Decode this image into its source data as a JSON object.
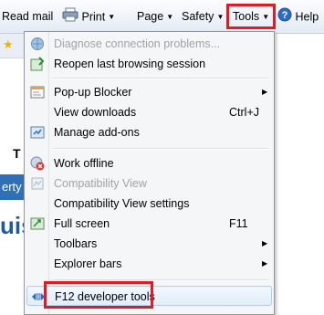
{
  "toolbar": {
    "read_mail": "Read mail",
    "print": "Print",
    "page": "Page",
    "safety": "Safety",
    "tools": "Tools",
    "help": "Help"
  },
  "background": {
    "tab_fragment": "T",
    "link_fragment": "erty",
    "heading_fragment": "uis"
  },
  "menu": {
    "items": [
      {
        "label": "Diagnose connection problems...",
        "disabled": true
      },
      {
        "label": "Reopen last browsing session"
      },
      {
        "label": "Pop-up Blocker",
        "submenu": true
      },
      {
        "label": "View downloads",
        "shortcut": "Ctrl+J"
      },
      {
        "label": "Manage add-ons"
      },
      {
        "label": "Work offline"
      },
      {
        "label": "Compatibility View",
        "disabled": true
      },
      {
        "label": "Compatibility View settings"
      },
      {
        "label": "Full screen",
        "shortcut": "F11"
      },
      {
        "label": "Toolbars",
        "submenu": true
      },
      {
        "label": "Explorer bars",
        "submenu": true
      },
      {
        "label": "F12 developer tools"
      }
    ]
  },
  "colors": {
    "highlight": "#e01b24",
    "hover": "#e1edfb",
    "disabled_text": "#a2a2a2"
  }
}
